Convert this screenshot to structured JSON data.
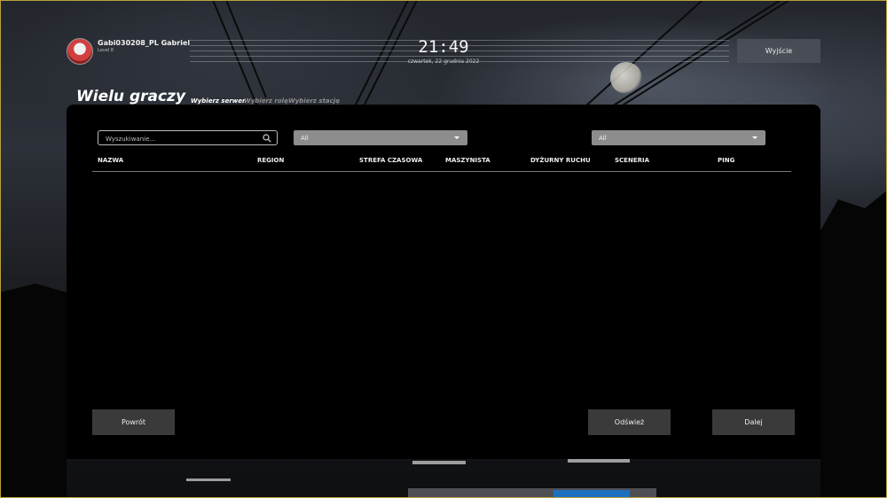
{
  "player": {
    "name": "Gabi030208_PL Gabriel",
    "level": "Level 8"
  },
  "clock": {
    "time": "21:49",
    "date": "czwartek, 22 grudnia 2022"
  },
  "header": {
    "exit_label": "Wyjście",
    "title": "Wielu graczy",
    "steps": [
      {
        "label": "Wybierz serwer",
        "active": true
      },
      {
        "label": "Wybierz rolę",
        "active": false
      },
      {
        "label": "Wybierz stację",
        "active": false
      }
    ]
  },
  "filters": {
    "search_placeholder": "Wyszukiwanie...",
    "region_value": "All",
    "second_value": "All"
  },
  "table": {
    "columns": [
      "NAZWA",
      "REGION",
      "STREFA CZASOWA",
      "MASZYNISTA",
      "DYŻURNY RUCHU",
      "SCENERIA",
      "PING"
    ],
    "rows": []
  },
  "footer": {
    "back_label": "Powrót",
    "refresh_label": "Odśwież",
    "next_label": "Dalej"
  },
  "icons": {
    "search": "search-icon",
    "chevron": "chevron-down-icon",
    "avatar": "avatar"
  }
}
